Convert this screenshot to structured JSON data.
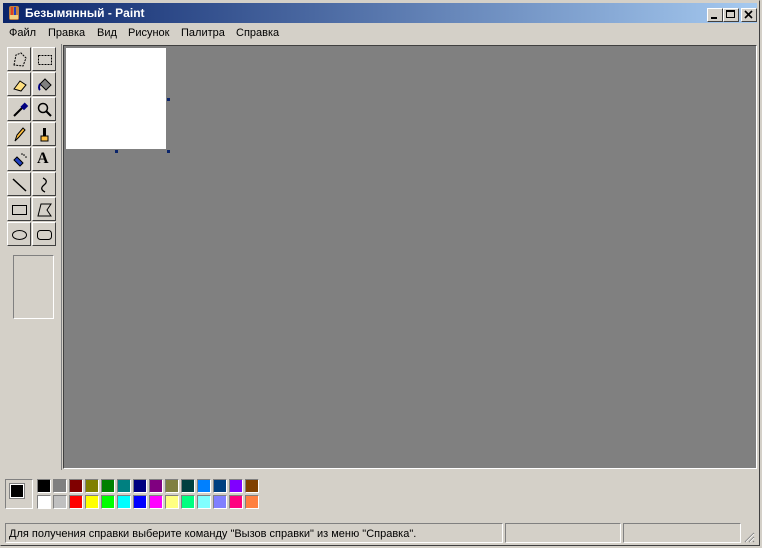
{
  "window": {
    "title": "Безымянный - Paint"
  },
  "menu": [
    "Файл",
    "Правка",
    "Вид",
    "Рисунок",
    "Палитра",
    "Справка"
  ],
  "tools": [
    {
      "name": "free-select-icon"
    },
    {
      "name": "rect-select-icon"
    },
    {
      "name": "eraser-icon"
    },
    {
      "name": "fill-bucket-icon"
    },
    {
      "name": "color-picker-icon"
    },
    {
      "name": "magnifier-icon"
    },
    {
      "name": "pencil-icon"
    },
    {
      "name": "brush-icon"
    },
    {
      "name": "airbrush-icon"
    },
    {
      "name": "text-tool-icon",
      "label": "A"
    },
    {
      "name": "line-icon"
    },
    {
      "name": "curve-icon"
    },
    {
      "name": "rectangle-icon"
    },
    {
      "name": "polygon-icon"
    },
    {
      "name": "ellipse-icon"
    },
    {
      "name": "rounded-rect-icon"
    }
  ],
  "colors": {
    "foreground": "#000000",
    "background": "#ffffff",
    "palette_top": [
      "#000000",
      "#808080",
      "#800000",
      "#808000",
      "#008000",
      "#008080",
      "#000080",
      "#800080",
      "#808040",
      "#004040",
      "#0080ff",
      "#004080",
      "#8000ff",
      "#804000"
    ],
    "palette_bottom": [
      "#ffffff",
      "#c0c0c0",
      "#ff0000",
      "#ffff00",
      "#00ff00",
      "#00ffff",
      "#0000ff",
      "#ff00ff",
      "#ffff80",
      "#00ff80",
      "#80ffff",
      "#8080ff",
      "#ff0080",
      "#ff8040"
    ]
  },
  "status": {
    "help_text": "Для получения справки выберите команду \"Вызов справки\" из меню \"Справка\".",
    "coords": "",
    "size": ""
  }
}
